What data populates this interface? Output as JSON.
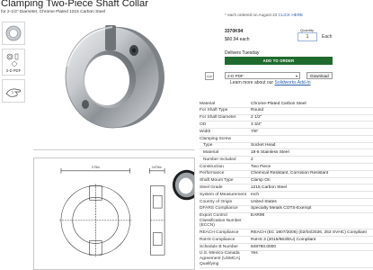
{
  "header": {
    "title": "Clamping Two-Piece Shaft Collar",
    "subtitle": "for 2-1/2\" Diameter, Chrome Plated 1215 Carbon Steel"
  },
  "thumbnails": [
    {
      "name": "photo-thumbnail"
    },
    {
      "name": "2d-pdf-thumbnail",
      "label": "2-D PDF"
    },
    {
      "name": "hand-thumbnail"
    }
  ],
  "purchase": {
    "ship_note_prefix": "* each ordered on August 23",
    "ship_note_link": "CLICK HERE",
    "part_number": "3370K94",
    "price": "$60.94 each",
    "quantity_label": "Quantity",
    "quantity_value": "1",
    "each_label": "Each",
    "delivery": "Delivers Tuesday",
    "add_to_order": "ADD TO ORDER",
    "cad_icon": "cad-icon",
    "cad_format": "2-D PDF",
    "download": "Download",
    "learn_prefix": "Learn more about our ",
    "learn_link": "Solidworks Add-In"
  },
  "specs": [
    {
      "k": "Material",
      "v": "Chrome-Plated Carbon Steel"
    },
    {
      "k": "For Shaft Type",
      "v": "Round"
    },
    {
      "k": "For Shaft Diameter",
      "v": "2 1/2\""
    },
    {
      "k": "OD",
      "v": "3 3/4\""
    },
    {
      "k": "Width",
      "v": "7/8\""
    },
    {
      "k": "Clamping Screw",
      "v": ""
    },
    {
      "k": "Type",
      "v": "Socket Head",
      "sub": true
    },
    {
      "k": "Material",
      "v": "18-8 Stainless Steel",
      "sub": true
    },
    {
      "k": "Number Included",
      "v": "2",
      "sub": true
    },
    {
      "k": "Construction",
      "v": "Two Piece"
    },
    {
      "k": "Performance",
      "v": "Chemical Resistant, Corrosion Resistant"
    },
    {
      "k": "Shaft Mount Type",
      "v": "Clamp On"
    },
    {
      "k": "Steel Grade",
      "v": "1215 Carbon Steel"
    },
    {
      "k": "System of Measurement",
      "v": "Inch"
    },
    {
      "k": "Country of Origin",
      "v": "United States"
    },
    {
      "k": "DFARS Compliance",
      "v": "Specialty Metals COTS-Exempt"
    },
    {
      "k": "Export Control Classification Number (ECCN)",
      "v": "EAR99"
    },
    {
      "k": "REACH Compliance",
      "v": "REACH (EC 1907/2006) (02/04/2026, 253 SVHC) Compliant"
    },
    {
      "k": "RoHS Compliance",
      "v": "RoHS 3 (2015/863/EU) Compliant"
    },
    {
      "k": "Schedule B Number",
      "v": "848790.0000"
    },
    {
      "k": "U.S.-Mexico-Canada Agreement (USMCA) Qualifying",
      "v": "Yes"
    }
  ],
  "drawing": {
    "dim_od": "3.75in",
    "dim_width": "0.875in"
  },
  "colors": {
    "order_green": "#1f6b2e",
    "link_blue": "#2a5db0"
  }
}
